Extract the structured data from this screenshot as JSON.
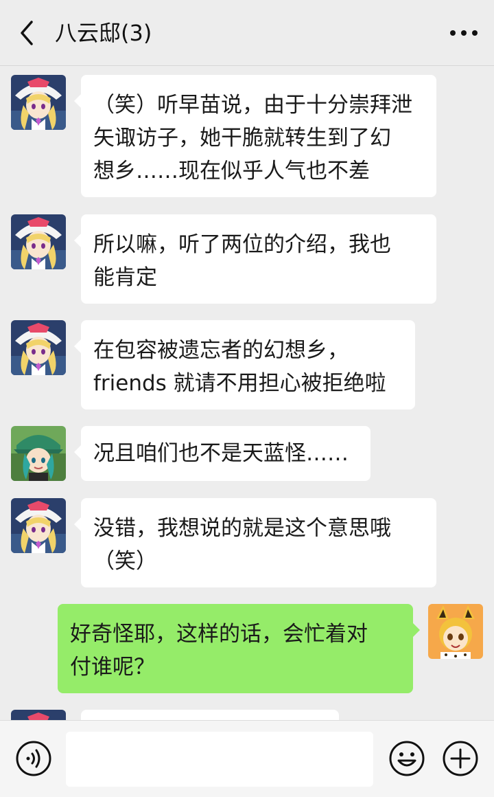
{
  "header": {
    "title": "八云邸(3)",
    "back_icon": "chevron-left-icon",
    "more_icon": "more-dots-icon"
  },
  "messages": [
    {
      "side": "left",
      "sender": "yukari",
      "text": "（笑）听早苗说，由于十分崇拜泄\n矢诹访子，她干脆就转生到了幻\n想乡……现在似乎人气也不差"
    },
    {
      "side": "left",
      "sender": "yukari",
      "text": "所以嘛，听了两位的介绍，我也\n能肯定"
    },
    {
      "side": "left",
      "sender": "yukari",
      "text": "在包容被遗忘者的幻想乡，\nfriends 就请不用担心被拒绝啦"
    },
    {
      "side": "left",
      "sender": "green-hair",
      "text": "况且咱们也不是天蓝怪……"
    },
    {
      "side": "left",
      "sender": "yukari",
      "text": "没错，我想说的就是这个意思哦\n（笑）"
    },
    {
      "side": "right",
      "sender": "serval",
      "text": "好奇怪耶，这样的话，会忙着对\n付谁呢？"
    }
  ],
  "bottom_bar": {
    "voice_icon": "voice-icon",
    "emoji_icon": "emoji-icon",
    "plus_icon": "plus-icon",
    "input_value": ""
  },
  "colors": {
    "background": "#ededed",
    "bubble_left": "#ffffff",
    "bubble_right": "#95ec69"
  }
}
